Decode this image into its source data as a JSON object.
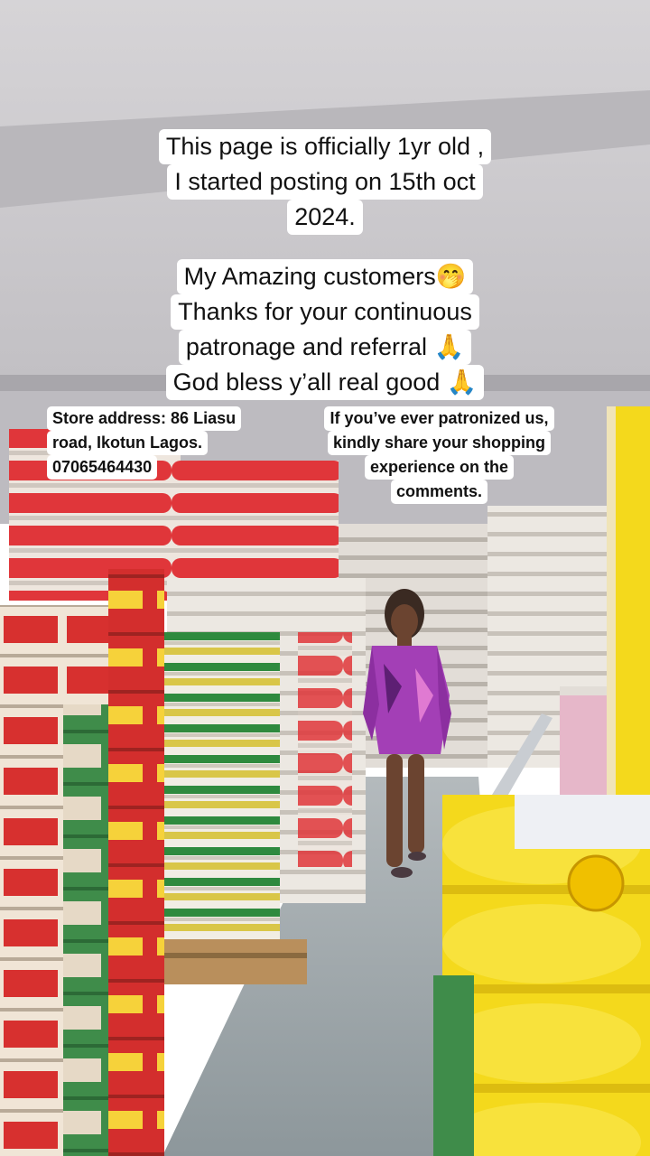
{
  "captions": {
    "anniversary": [
      "This page is officially 1yr old ,",
      "I started posting on 15th oct",
      "2024."
    ],
    "thanks": [
      "My Amazing customers🤭",
      "Thanks for your continuous",
      "patronage and referral 🙏",
      "God bless y’all real good 🙏"
    ],
    "store": [
      "Store address: 86 Liasu",
      "road, Ikotun Lagos.",
      "07065464430"
    ],
    "share": [
      "If you’ve ever patronized us,",
      "kindly share your shopping",
      "experience on the",
      "comments."
    ]
  },
  "colors": {
    "ceiling": "#cfcdd0",
    "wall": "#c5c3c6",
    "floor": "#9aa3a6",
    "sack_red": "#e0363a",
    "sack_white": "#efeae3",
    "sack_green": "#2f8a3e",
    "sack_yellow": "#f4d91c",
    "carton_red": "#d7302f",
    "dress_purple": "#a33fb6"
  }
}
